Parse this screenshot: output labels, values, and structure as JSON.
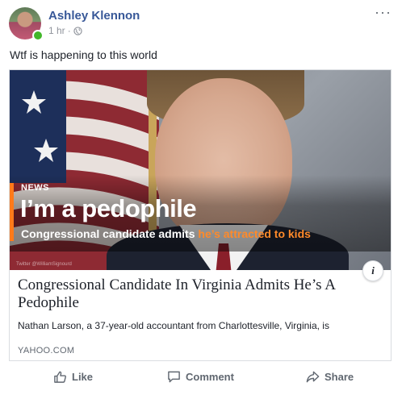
{
  "post": {
    "author": "Ashley Klennon",
    "time": "1 hr",
    "separator": "·",
    "more": "···",
    "text": "Wtf is happening to this world"
  },
  "link": {
    "image": {
      "tag": "NEWS",
      "headline": "I’m a pedophile",
      "subline_white": "Congressional candidate admits ",
      "subline_highlight": "he’s attracted to kids",
      "credit": "Twitter @WilliamSignourd",
      "accent_color": "#ff7a1a"
    },
    "title": "Congressional Candidate In Virginia Admits He’s A Pedophile",
    "description": "Nathan Larson, a 37-year-old accountant from Charlottesville, Virginia, is",
    "domain": "YAHOO.COM",
    "info": "i"
  },
  "actions": {
    "like": "Like",
    "comment": "Comment",
    "share": "Share"
  },
  "colors": {
    "author": "#385898",
    "online": "#42b72a",
    "muted": "#606770"
  }
}
